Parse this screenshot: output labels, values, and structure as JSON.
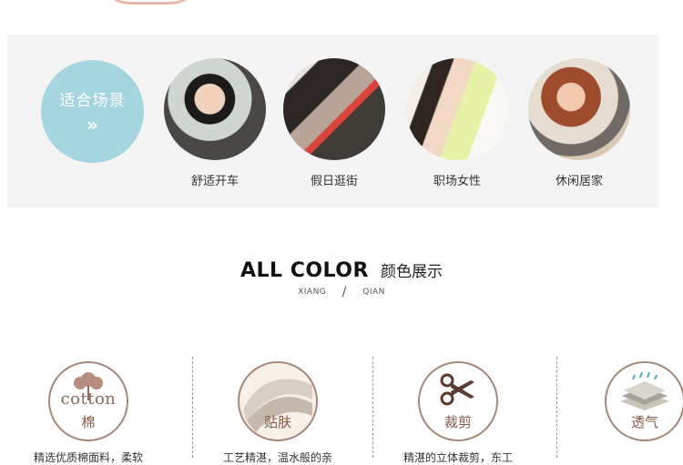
{
  "scene": {
    "badge": {
      "title": "适合场景",
      "arrow": "»"
    },
    "items": [
      {
        "label": "舒适开车",
        "icon": "driving-photo"
      },
      {
        "label": "假日逛街",
        "icon": "shopping-photo"
      },
      {
        "label": "职场女性",
        "icon": "office-photo"
      },
      {
        "label": "休闲居家",
        "icon": "home-photo"
      }
    ]
  },
  "color_section": {
    "title": "ALL COLOR",
    "title_cn": "颜色展示",
    "pinyin_left": "XIANG",
    "pinyin_right": "QIAN",
    "slash": "/"
  },
  "features": {
    "items": [
      {
        "label": "棉",
        "word": "cotton",
        "desc": "精选优质棉面料，柔软",
        "icon": "cotton-icon"
      },
      {
        "label": "贴肤",
        "desc": "工艺精湛，温水般的亲",
        "icon": "fabric-icon"
      },
      {
        "label": "裁剪",
        "desc": "精湛的立体裁剪，东工",
        "icon": "scissors-icon"
      },
      {
        "label": "透气",
        "desc": "",
        "icon": "breathable-icon"
      }
    ]
  },
  "colors": {
    "badge_blue": "#a6d5e2",
    "accent_brown": "#a48778",
    "text_brown": "#8a5a4a",
    "panel_gray": "#f4f4f4"
  }
}
